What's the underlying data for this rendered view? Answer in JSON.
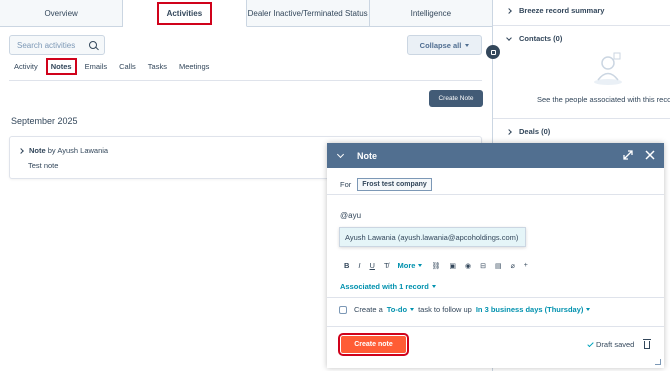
{
  "tabs": [
    {
      "label": "Overview",
      "active": false
    },
    {
      "label": "Activities",
      "active": true
    },
    {
      "label": "Dealer Inactive/Terminated Status",
      "active": false
    },
    {
      "label": "Intelligence",
      "active": false
    }
  ],
  "search": {
    "placeholder": "Search activities"
  },
  "collapse_label": "Collapse all",
  "subtabs": [
    {
      "label": "Activity",
      "active": false
    },
    {
      "label": "Notes",
      "active": true
    },
    {
      "label": "Emails",
      "active": false
    },
    {
      "label": "Calls",
      "active": false
    },
    {
      "label": "Tasks",
      "active": false
    },
    {
      "label": "Meetings",
      "active": false
    }
  ],
  "create_note_top": "Create Note",
  "month": "September 2025",
  "note_card": {
    "type": "Note",
    "by": "by Ayush Lawania",
    "body": "Test note"
  },
  "sidebar": {
    "breeze": "Breeze record summary",
    "contacts": "Contacts (0)",
    "contacts_empty": "See the people associated with this reco",
    "deals": "Deals (0)"
  },
  "note_panel": {
    "title": "Note",
    "for_label": "For",
    "for_value": "Frost test company",
    "typed_text": "@ayu",
    "mention_option": "Ayush Lawania (ayush.lawania@apcoholdings.com)",
    "toolbar": {
      "bold": "B",
      "italic": "I",
      "underline": "U",
      "clear": "T̸",
      "more": "More"
    },
    "associated": "Associated with 1 record",
    "todo_prefix": "Create a",
    "todo_type": "To-do",
    "todo_middle": "task to follow up",
    "todo_when": "In 3 business days (Thursday)",
    "create_button": "Create note",
    "draft_status": "Draft saved"
  },
  "colors": {
    "accent": "#ff5c35",
    "header": "#516f90",
    "link": "#0091ae",
    "highlight": "#d0021b"
  }
}
